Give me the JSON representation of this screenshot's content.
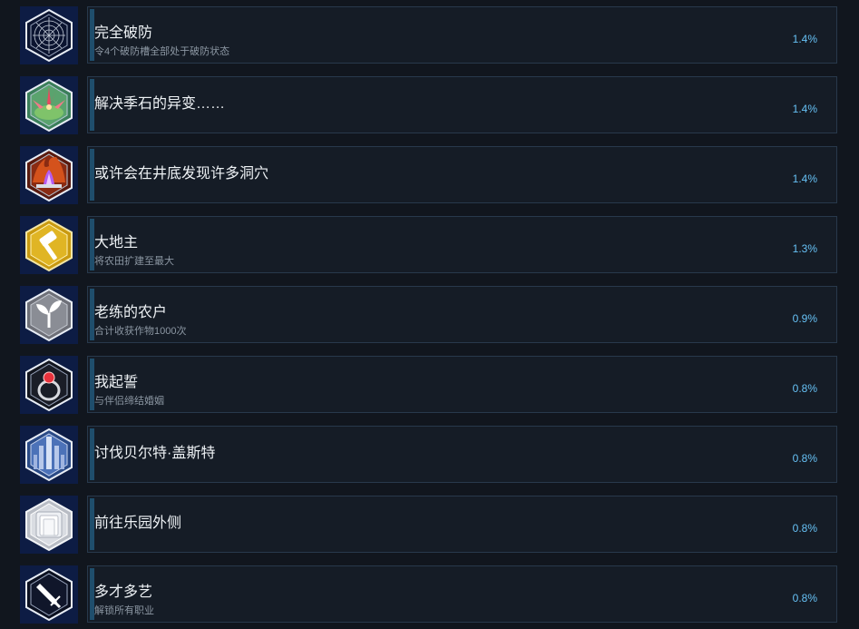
{
  "achievements": [
    {
      "title": "完全破防",
      "desc": "令4个破防槽全部处于破防状态",
      "percent": "1.4%",
      "icon": "web-icon"
    },
    {
      "title": "解决季石的异变……",
      "desc": "",
      "percent": "1.4%",
      "icon": "crystal-flower-icon"
    },
    {
      "title": "或许会在井底发现许多洞穴",
      "desc": "",
      "percent": "1.4%",
      "icon": "flame-cave-icon"
    },
    {
      "title": "大地主",
      "desc": "将农田扩建至最大",
      "percent": "1.3%",
      "icon": "hammer-icon"
    },
    {
      "title": "老练的农户",
      "desc": "合计收获作物1000次",
      "percent": "0.9%",
      "icon": "sprout-icon"
    },
    {
      "title": "我起誓",
      "desc": "与伴侣缔结婚姻",
      "percent": "0.8%",
      "icon": "ring-icon"
    },
    {
      "title": "讨伐贝尔特·盖斯特",
      "desc": "",
      "percent": "0.8%",
      "icon": "castle-icon"
    },
    {
      "title": "前往乐园外侧",
      "desc": "",
      "percent": "0.8%",
      "icon": "gate-icon"
    },
    {
      "title": "多才多艺",
      "desc": "解锁所有职业",
      "percent": "0.8%",
      "icon": "sword-icon"
    }
  ],
  "colors": {
    "panel_bg": "#151c26",
    "panel_border": "#28394c",
    "accent_bar": "#1f4e6c",
    "title": "#eef2f5",
    "desc": "#8c97a3",
    "percent": "#66c0f4"
  }
}
